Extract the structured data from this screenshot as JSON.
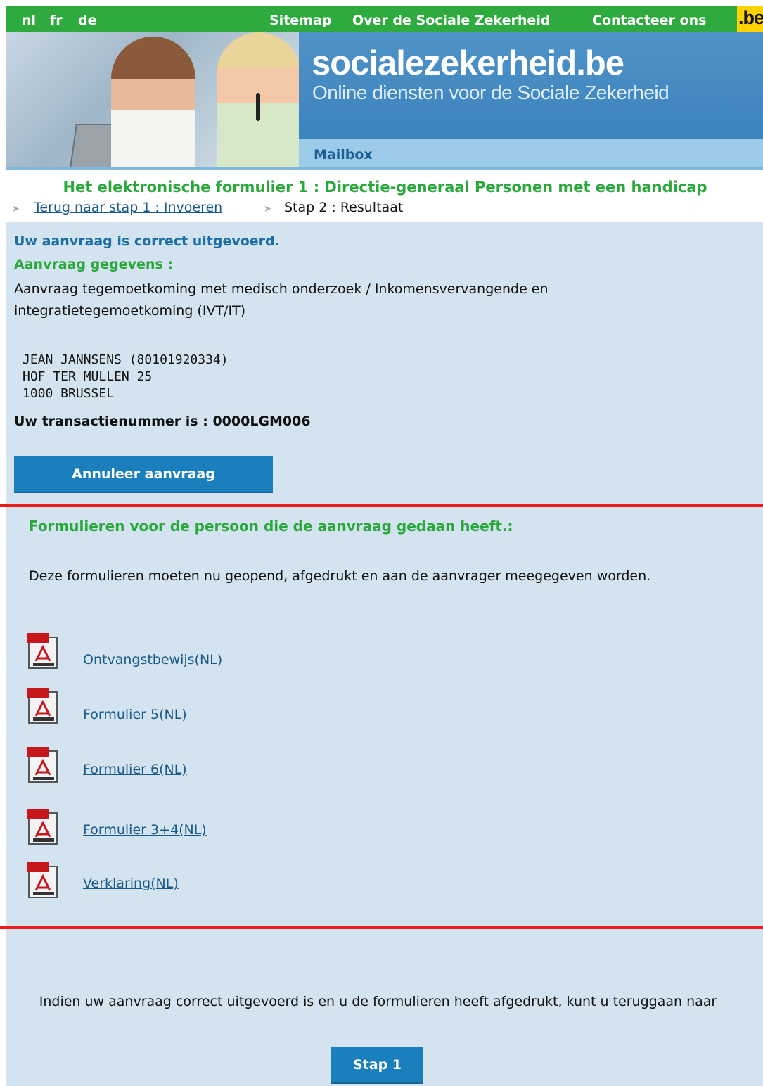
{
  "topbar": {
    "languages": [
      "nl",
      "fr",
      "de"
    ],
    "links": [
      "Sitemap",
      "Over de Sociale Zekerheid",
      "Contacteer ons"
    ],
    "be_logo": ".be"
  },
  "banner": {
    "title": "socialezekerheid.be",
    "subtitle": "Online diensten voor de Sociale Zekerheid",
    "mailbox": "Mailbox"
  },
  "form": {
    "title": "Het elektronische formulier 1 : Directie-generaal Personen met een handicap",
    "breadcrumb_back": "Terug naar stap 1 : Invoeren",
    "breadcrumb_current": "Stap 2 : Resultaat"
  },
  "result": {
    "success": "Uw aanvraag is correct uitgevoerd.",
    "details_heading": "Aanvraag gegevens :",
    "description": "Aanvraag tegemoetkoming met medisch onderzoek  /  Inkomensvervangende en integratietegemoetkoming (IVT/IT)",
    "address": [
      "JEAN JANNSENS (80101920334)",
      "HOF TER MULLEN 25",
      "1000 BRUSSEL"
    ],
    "transaction": "Uw transactienummer is : 0000LGM006",
    "cancel_button": "Annuleer aanvraag"
  },
  "forms_section": {
    "heading": "Formulieren voor de persoon die de aanvraag gedaan heeft.:",
    "description": "Deze formulieren moeten nu geopend, afgedrukt en aan de aanvrager meegegeven worden.",
    "documents": [
      "Ontvangstbewijs(NL)",
      "Formulier 5(NL)",
      "Formulier 6(NL)",
      "Formulier 3+4(NL)",
      "Verklaring(NL)"
    ],
    "icon": "pdf-file-icon"
  },
  "footer": {
    "text": "Indien uw aanvraag correct uitgevoerd is en u de formulieren heeft afgedrukt, kunt u teruggaan naar",
    "step_button": "Stap 1"
  },
  "colors": {
    "green": "#2eaa3f",
    "blue_button": "#1c7fbd",
    "panel": "#d3e3ef",
    "red_line": "#ee1d1d",
    "link": "#1a5a8a"
  }
}
